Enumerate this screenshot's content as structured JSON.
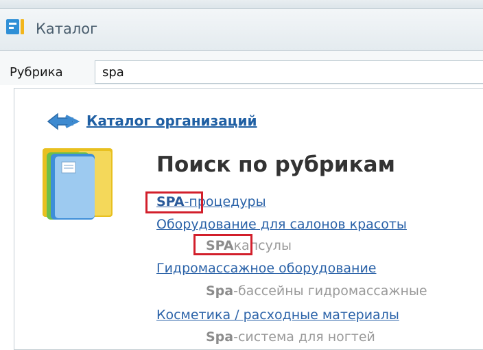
{
  "window": {
    "title": "Каталог",
    "icon": "app-window-icon"
  },
  "rubric": {
    "label": "Рубрика",
    "value": "spa"
  },
  "catalog_link": {
    "label": "Каталог организаций",
    "icon": "back-arrow-icon"
  },
  "search": {
    "heading": "Поиск по рубрикам",
    "folder_icon": "folder-documents-icon",
    "results": [
      {
        "highlight": "SPA",
        "rest": "-процедуры"
      },
      {
        "category": "Оборудование для салонов красоты",
        "highlight": "SPA",
        "rest": "капсулы"
      },
      {
        "category": "Гидромассажное оборудование",
        "highlight": "Spa",
        "rest": "-бассейны гидромассажные"
      },
      {
        "category": "Косметика / расходные материалы",
        "highlight": "Spa",
        "rest": "-система для ногтей"
      }
    ]
  },
  "colors": {
    "link": "#2a62a8",
    "highlight_box": "#d21f2b",
    "muted": "#9a9a9a"
  }
}
